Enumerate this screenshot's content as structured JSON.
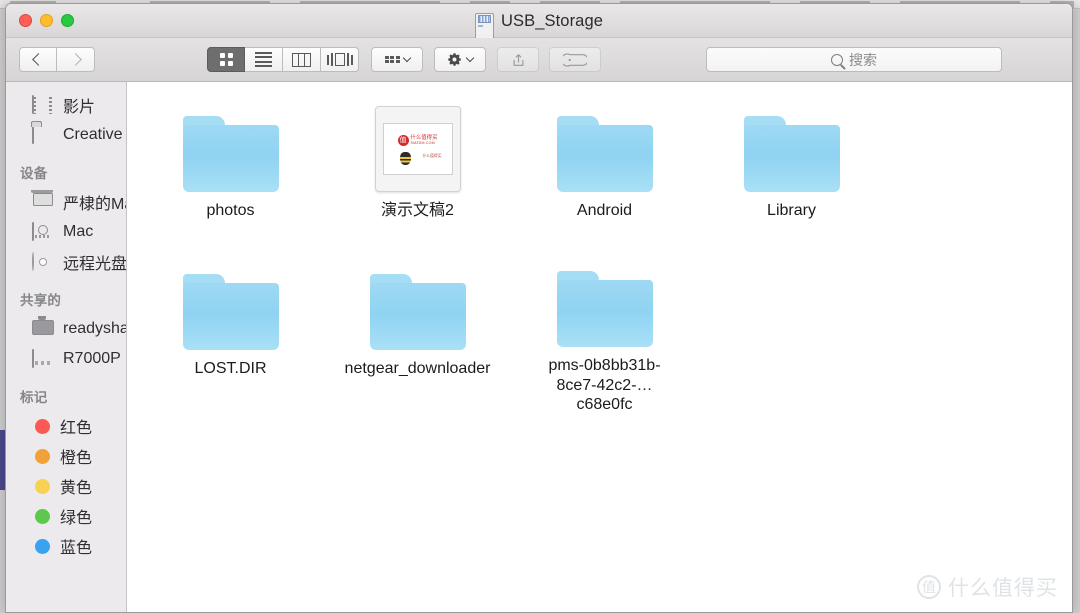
{
  "window": {
    "title": "USB_Storage",
    "title_icon": "external-drive-icon",
    "traffic_lights": {
      "close": "close",
      "minimize": "minimize",
      "zoom": "zoom"
    }
  },
  "toolbar": {
    "back_label": "back",
    "forward_label": "forward",
    "view_modes": [
      {
        "name": "icon-view",
        "label": "icon-grid-icon",
        "active": true
      },
      {
        "name": "list-view",
        "label": "list-icon",
        "active": false
      },
      {
        "name": "column-view",
        "label": "columns-icon",
        "active": false
      },
      {
        "name": "gallery-view",
        "label": "gallery-icon",
        "active": false
      }
    ],
    "arrange_label": "arrange-icon",
    "action_label": "gear-icon",
    "share_label": "share-icon",
    "tag_label": "tag-icon",
    "share_disabled": true,
    "tag_disabled": true
  },
  "search": {
    "placeholder": "搜索",
    "value": ""
  },
  "sidebar": {
    "top_items": [
      {
        "label": "影片",
        "icon": "film-icon"
      },
      {
        "label": "Creative Cloud Files",
        "icon": "folder-icon"
      }
    ],
    "sections": [
      {
        "header": "设备",
        "items": [
          {
            "label": "严棣的MacBook Pro",
            "icon": "laptop-icon",
            "eject": false
          },
          {
            "label": "Mac",
            "icon": "hard-drive-icon",
            "eject": false
          },
          {
            "label": "远程光盘",
            "icon": "optical-disc-icon",
            "eject": false
          }
        ]
      },
      {
        "header": "共享的",
        "items": [
          {
            "label": "readyshare",
            "icon": "monitor-icon",
            "eject": true
          },
          {
            "label": "R7000P",
            "icon": "nas-icon",
            "eject": false
          }
        ]
      },
      {
        "header": "标记",
        "items": [
          {
            "label": "红色",
            "icon": "tag-dot-icon",
            "color": "#fa5a52"
          },
          {
            "label": "橙色",
            "icon": "tag-dot-icon",
            "color": "#f0a13a"
          },
          {
            "label": "黄色",
            "icon": "tag-dot-icon",
            "color": "#f7d košic"
          },
          {
            "label": "绿色",
            "icon": "tag-dot-icon",
            "color": "#5cc84f"
          },
          {
            "label": "蓝色",
            "icon": "tag-dot-icon",
            "color": "#3aa3ef"
          }
        ]
      }
    ]
  },
  "files": [
    {
      "name": "photos",
      "kind": "folder"
    },
    {
      "name": "演示文稿2",
      "kind": "document",
      "thumb": {
        "logo_badge": "值",
        "logo_line1": "什么值得买",
        "logo_line2": "SMZDM.COM",
        "byline": "什么值得买"
      }
    },
    {
      "name": "Android",
      "kind": "folder"
    },
    {
      "name": "Library",
      "kind": "folder"
    },
    {
      "name": "",
      "kind": "empty"
    },
    {
      "name": "LOST.DIR",
      "kind": "folder"
    },
    {
      "name": "netgear_downloader",
      "kind": "folder"
    },
    {
      "name": "pms-0b8bb31b-8ce7-42c2-…c68e0fc",
      "kind": "folder"
    }
  ],
  "watermark": {
    "badge": "值",
    "text": "什么值得买"
  },
  "colors": {
    "folder_blue": "#8fd3f2",
    "titlebar": "#e2e0e0",
    "sidebar_bg": "#eceaec",
    "active_view_btn": "#6e6e6e",
    "accent_red": "#d32b2b"
  }
}
